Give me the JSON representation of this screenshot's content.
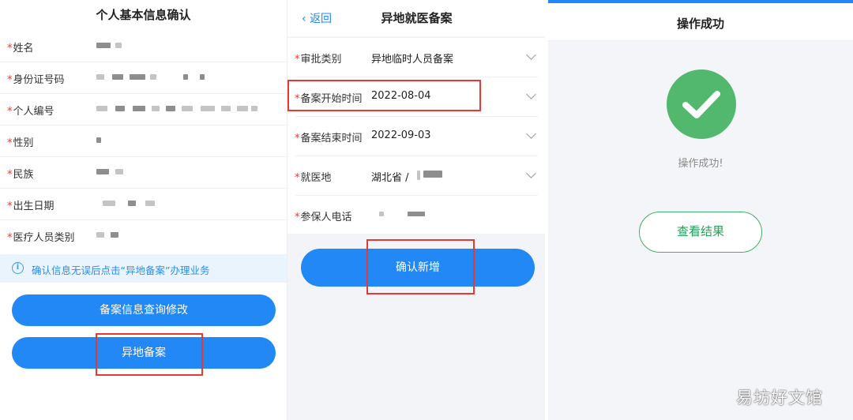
{
  "panel1": {
    "title": "个人基本信息确认",
    "required_mark": "*",
    "fields": [
      {
        "label": "姓名"
      },
      {
        "label": "身份证号码"
      },
      {
        "label": "个人编号"
      },
      {
        "label": "性别"
      },
      {
        "label": "民族"
      },
      {
        "label": "出生日期"
      },
      {
        "label": "医疗人员类别"
      }
    ],
    "notice_icon": "i",
    "notice": "确认信息无误后点击“异地备案”办理业务",
    "query_button": "备案信息查询修改",
    "remote_button": "异地备案",
    "highlight_color": "#e53935",
    "accent_color": "#2188f5"
  },
  "panel2": {
    "back_label": "返回",
    "title": "异地就医备案",
    "rows": [
      {
        "label": "审批类别",
        "value": "异地临时人员备案",
        "dropdown": true
      },
      {
        "label": "备案开始时间",
        "value": "2022-08-04",
        "dropdown": true
      },
      {
        "label": "备案结束时间",
        "value": "2022-09-03",
        "dropdown": true
      },
      {
        "label": "就医地",
        "value": "湖北省 /",
        "dropdown": true
      },
      {
        "label": "参保人电话",
        "value": "",
        "dropdown": false
      }
    ],
    "confirm_button": "确认新增"
  },
  "panel3": {
    "title": "操作成功",
    "success_icon": "check-circle-icon",
    "success_color": "#52b86e",
    "message": "操作成功!",
    "view_button": "查看结果"
  },
  "watermark": "易坊好文馆"
}
